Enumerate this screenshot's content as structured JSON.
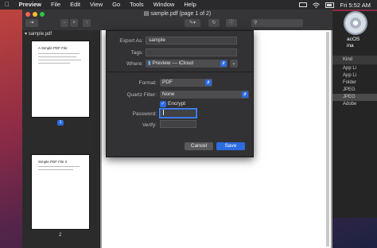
{
  "menubar": {
    "apple_icon": "apple-logo",
    "items": [
      "Preview",
      "File",
      "Edit",
      "View",
      "Go",
      "Tools",
      "Window",
      "Help"
    ],
    "clock": "Fri 5:52 AM"
  },
  "desktop": {
    "disc_label_line1": "acOS",
    "disc_label_line2": "ina"
  },
  "background_window": {
    "column_header": "Kind",
    "rows": [
      "App Li",
      "App Li",
      "Folder",
      "JPEG",
      "JPEG",
      "Adobe"
    ]
  },
  "window": {
    "title": "sample.pdf (page 1 of 2)",
    "sidebar_header": "sample.pdf",
    "pages": [
      {
        "number": "1",
        "title": "A Simple PDF File"
      },
      {
        "number": "2",
        "title": "Simple PDF File 2"
      }
    ]
  },
  "export": {
    "export_as_label": "Export As:",
    "export_as_value": "sample",
    "tags_label": "Tags:",
    "where_label": "Where:",
    "where_value": "Preview — iCloud",
    "format_label": "Format:",
    "format_value": "PDF",
    "quartz_label": "Quartz Filter:",
    "quartz_value": "None",
    "encrypt_label": "Encrypt",
    "encrypt_checked": true,
    "password_label": "Password:",
    "verify_label": "Verify:",
    "cancel_label": "Cancel",
    "save_label": "Save"
  },
  "colors": {
    "accent": "#2c6be0",
    "sheet_bg": "#323234",
    "menubar_bg": "#2a2a2c"
  }
}
